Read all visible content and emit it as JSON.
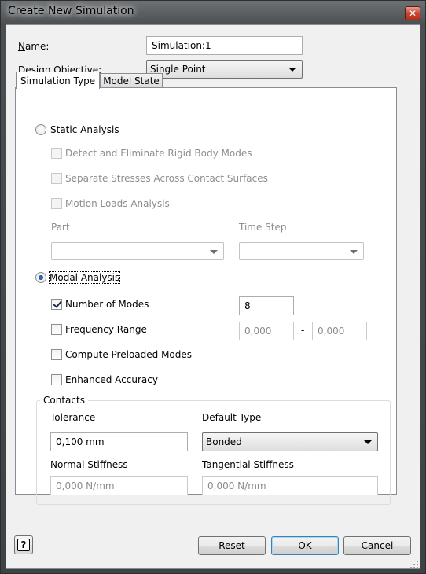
{
  "window": {
    "title": "Create New Simulation",
    "close_glyph": "✕"
  },
  "header": {
    "name_label": "Name:",
    "name_value": "Simulation:1",
    "objective_label": "Design Objective:",
    "objective_value": "Single Point"
  },
  "tabs": [
    {
      "label": "Simulation Type",
      "active": true
    },
    {
      "label": "Model State",
      "active": false
    }
  ],
  "static": {
    "label": "Static Analysis",
    "selected": false,
    "options": [
      {
        "label": "Detect and Eliminate Rigid Body Modes",
        "checked": false
      },
      {
        "label": "Separate Stresses Across Contact Surfaces",
        "checked": false
      },
      {
        "label": "Motion Loads Analysis",
        "checked": false
      }
    ],
    "part_label": "Part",
    "time_step_label": "Time Step"
  },
  "modal": {
    "label": "Modal Analysis",
    "selected": true,
    "number_of_modes_label": "Number of Modes",
    "number_of_modes_checked": true,
    "number_of_modes_value": "8",
    "frequency_range_label": "Frequency Range",
    "frequency_range_checked": false,
    "freq_from": "0,000",
    "freq_sep": "-",
    "freq_to": "0,000",
    "preloaded_label": "Compute Preloaded Modes",
    "preloaded_checked": false,
    "enhanced_label": "Enhanced Accuracy",
    "enhanced_checked": false
  },
  "contacts": {
    "title": "Contacts",
    "tolerance_label": "Tolerance",
    "tolerance_value": "0,100 mm",
    "default_type_label": "Default Type",
    "default_type_value": "Bonded",
    "normal_stiffness_label": "Normal Stiffness",
    "normal_stiffness_value": "0,000 N/mm",
    "tangential_stiffness_label": "Tangential Stiffness",
    "tangential_stiffness_value": "0,000 N/mm"
  },
  "buttons": {
    "help": "?",
    "reset": "Reset",
    "ok": "OK",
    "cancel": "Cancel"
  },
  "icons": [
    "close-icon",
    "help-icon",
    "dropdown-arrow-icon",
    "size-gripper-icon"
  ]
}
